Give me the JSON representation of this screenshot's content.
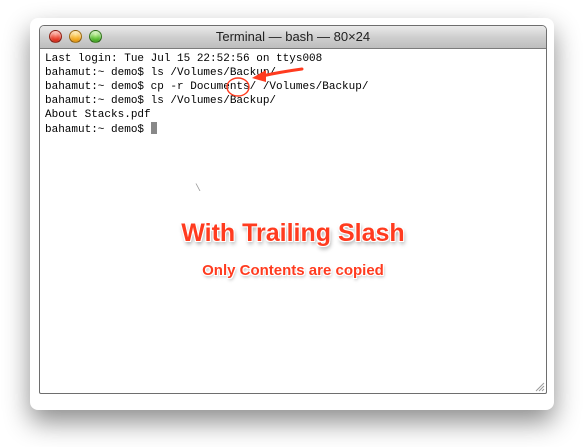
{
  "window": {
    "title": "Terminal — bash — 80×24"
  },
  "terminal": {
    "lines": [
      "Last login: Tue Jul 15 22:52:56 on ttys008",
      "bahamut:~ demo$ ls /Volumes/Backup/",
      "bahamut:~ demo$ cp -r Documents/ /Volumes/Backup/",
      "bahamut:~ demo$ ls /Volumes/Backup/",
      "About Stacks.pdf",
      "bahamut:~ demo$ "
    ],
    "stray_mark": "\\"
  },
  "annotation": {
    "heading": "With Trailing Slash",
    "subheading": "Only Contents are copied",
    "color": "#ff3b1f"
  },
  "icons": {
    "close": "close-icon",
    "minimize": "minimize-icon",
    "zoom": "zoom-icon",
    "resize": "resize-grip-icon",
    "arrow": "arrow-annotation",
    "circle": "circle-annotation"
  }
}
